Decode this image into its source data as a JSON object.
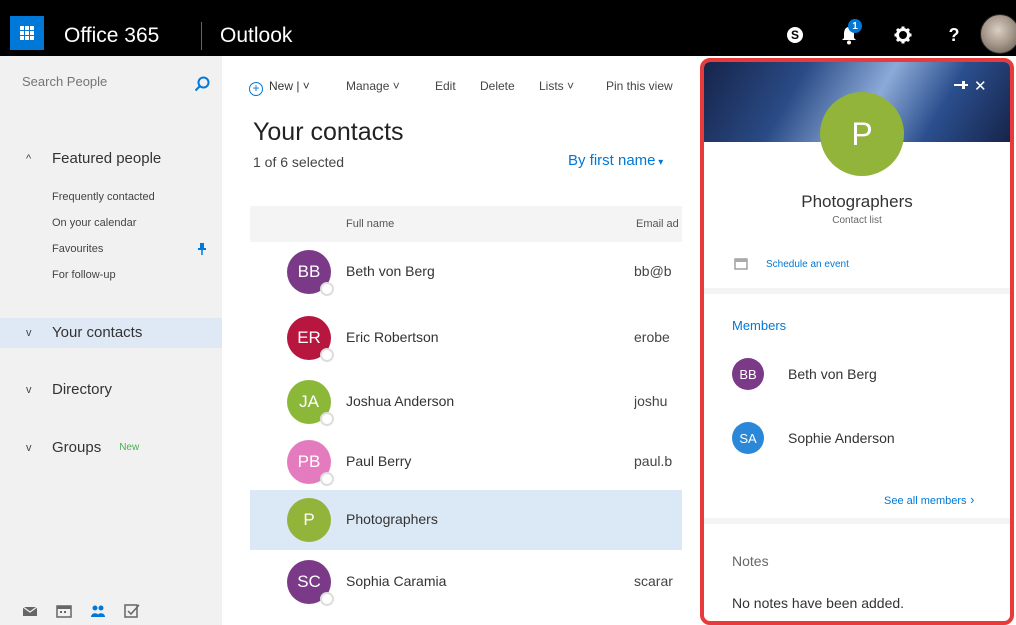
{
  "header": {
    "brand": "Office 365",
    "app": "Outlook",
    "notification_count": "1",
    "skype_label": "S",
    "help_label": "?"
  },
  "sidebar": {
    "search_placeholder": "Search People",
    "featured_label": "Featured people",
    "featured_items": [
      "Frequently contacted",
      "On your calendar",
      "Favourites",
      "For follow-up"
    ],
    "your_contacts": "Your contacts",
    "directory": "Directory",
    "groups": "Groups",
    "groups_badge": "New"
  },
  "toolbar": {
    "new": "New",
    "manage": "Manage",
    "edit": "Edit",
    "delete": "Delete",
    "lists": "Lists",
    "pin": "Pin this view"
  },
  "main": {
    "title": "Your contacts",
    "selected": "1 of 6 selected",
    "sort": "By first name",
    "columns": {
      "full_name": "Full name",
      "email": "Email ad"
    },
    "contacts": [
      {
        "initials": "BB",
        "name": "Beth von Berg",
        "email": "bb@b",
        "color": "#7b3a87"
      },
      {
        "initials": "ER",
        "name": "Eric Robertson",
        "email": "erobe",
        "color": "#b7173f"
      },
      {
        "initials": "JA",
        "name": "Joshua Anderson",
        "email": "joshu",
        "color": "#8cb83a"
      },
      {
        "initials": "PB",
        "name": "Paul Berry",
        "email": "paul.b",
        "color": "#e57bbf"
      },
      {
        "initials": "P",
        "name": "Photographers",
        "email": "",
        "color": "#92b43a"
      },
      {
        "initials": "SC",
        "name": "Sophia Caramia",
        "email": "scarar",
        "color": "#7b3a87"
      }
    ]
  },
  "pane": {
    "initial": "P",
    "name": "Photographers",
    "subtitle": "Contact list",
    "schedule": "Schedule an event",
    "members_title": "Members",
    "members": [
      {
        "initials": "BB",
        "name": "Beth von Berg",
        "color": "#7b3a87"
      },
      {
        "initials": "SA",
        "name": "Sophie Anderson",
        "color": "#2b88d8"
      }
    ],
    "see_all": "See all members",
    "notes_title": "Notes",
    "notes_text": "No notes have been added."
  },
  "colors": {
    "accent": "#0078d7",
    "highlight_border": "#e83a3a",
    "selected_row": "#dbe8f6"
  }
}
